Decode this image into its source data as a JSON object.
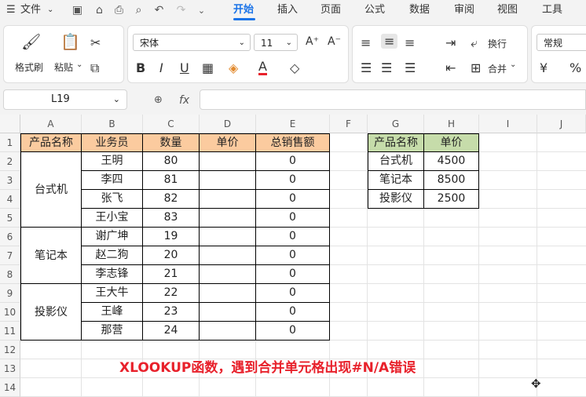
{
  "menu": {
    "file": "文件",
    "tabs": [
      {
        "label": "开始",
        "active": true
      },
      {
        "label": "插入"
      },
      {
        "label": "页面"
      },
      {
        "label": "公式"
      },
      {
        "label": "数据"
      },
      {
        "label": "审阅"
      },
      {
        "label": "视图"
      },
      {
        "label": "工具"
      }
    ]
  },
  "ribbon": {
    "format_painter": "格式刷",
    "paste": "粘贴",
    "font_name": "宋体",
    "font_size": "11",
    "wrap": "换行",
    "merge": "合并",
    "number_format": "常规",
    "bold": "B",
    "italic": "I",
    "underline": "U",
    "increase_font": "A⁺",
    "decrease_font": "A⁻",
    "currency": "¥",
    "percent": "%"
  },
  "formula_bar": {
    "cell_ref": "L19",
    "fx": "fx",
    "formula": ""
  },
  "columns": [
    "A",
    "B",
    "C",
    "D",
    "E",
    "F",
    "G",
    "H",
    "I",
    "J"
  ],
  "rows": [
    "1",
    "2",
    "3",
    "4",
    "5",
    "6",
    "7",
    "8",
    "9",
    "10",
    "11",
    "12",
    "13",
    "14"
  ],
  "table1": {
    "headers": [
      "产品名称",
      "业务员",
      "数量",
      "单价",
      "总销售额"
    ],
    "groups": [
      {
        "name": "台式机",
        "rows": [
          [
            "王明",
            "80",
            "",
            "0"
          ],
          [
            "李四",
            "81",
            "",
            "0"
          ],
          [
            "张飞",
            "82",
            "",
            "0"
          ],
          [
            "王小宝",
            "83",
            "",
            "0"
          ]
        ]
      },
      {
        "name": "笔记本",
        "rows": [
          [
            "谢广坤",
            "19",
            "",
            "0"
          ],
          [
            "赵二狗",
            "20",
            "",
            "0"
          ],
          [
            "李志锋",
            "21",
            "",
            "0"
          ]
        ]
      },
      {
        "name": "投影仪",
        "rows": [
          [
            "王大牛",
            "22",
            "",
            "0"
          ],
          [
            "王峰",
            "23",
            "",
            "0"
          ],
          [
            "那营",
            "24",
            "",
            "0"
          ]
        ]
      }
    ]
  },
  "table2": {
    "headers": [
      "产品名称",
      "单价"
    ],
    "rows": [
      [
        "台式机",
        "4500"
      ],
      [
        "笔记本",
        "8500"
      ],
      [
        "投影仪",
        "2500"
      ]
    ]
  },
  "annotation": "XLOOKUP函数，遇到合并单元格出现#N/A错误",
  "colors": {
    "accent": "#1a73e8",
    "header_orange": "#fbcb9f",
    "header_green": "#c6dcaa",
    "annotation_red": "#e8212b"
  }
}
